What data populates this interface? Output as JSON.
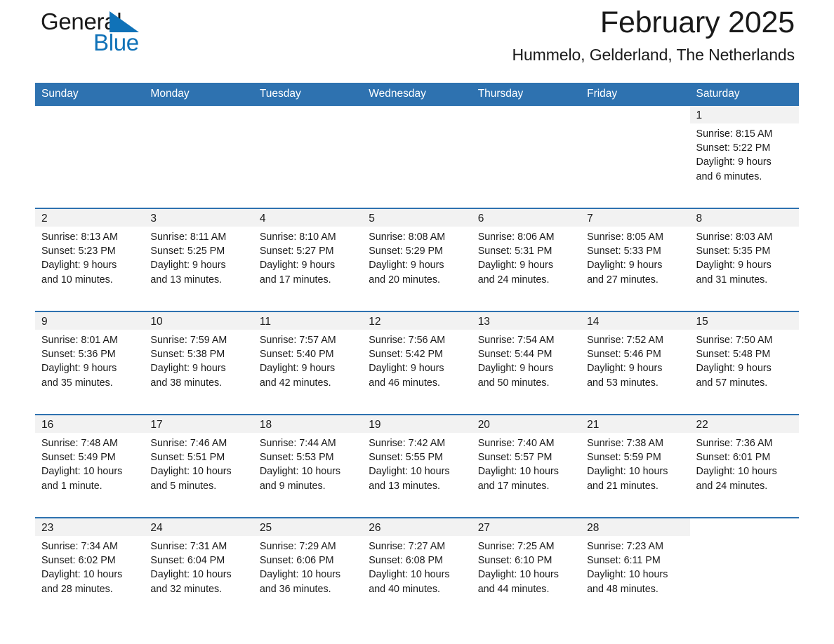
{
  "brand": {
    "name_part1": "General",
    "name_part2": "Blue",
    "color_primary": "#1072b8",
    "color_header": "#2e72b0"
  },
  "header": {
    "title": "February 2025",
    "subtitle": "Hummelo, Gelderland, The Netherlands"
  },
  "calendar": {
    "weekday_headers": [
      "Sunday",
      "Monday",
      "Tuesday",
      "Wednesday",
      "Thursday",
      "Friday",
      "Saturday"
    ],
    "weeks": [
      [
        {
          "day": "",
          "sunrise": "",
          "sunset": "",
          "daylight1": "",
          "daylight2": "",
          "empty": true
        },
        {
          "day": "",
          "sunrise": "",
          "sunset": "",
          "daylight1": "",
          "daylight2": "",
          "empty": true
        },
        {
          "day": "",
          "sunrise": "",
          "sunset": "",
          "daylight1": "",
          "daylight2": "",
          "empty": true
        },
        {
          "day": "",
          "sunrise": "",
          "sunset": "",
          "daylight1": "",
          "daylight2": "",
          "empty": true
        },
        {
          "day": "",
          "sunrise": "",
          "sunset": "",
          "daylight1": "",
          "daylight2": "",
          "empty": true
        },
        {
          "day": "",
          "sunrise": "",
          "sunset": "",
          "daylight1": "",
          "daylight2": "",
          "empty": true
        },
        {
          "day": "1",
          "sunrise": "Sunrise: 8:15 AM",
          "sunset": "Sunset: 5:22 PM",
          "daylight1": "Daylight: 9 hours",
          "daylight2": "and 6 minutes.",
          "empty": false
        }
      ],
      [
        {
          "day": "2",
          "sunrise": "Sunrise: 8:13 AM",
          "sunset": "Sunset: 5:23 PM",
          "daylight1": "Daylight: 9 hours",
          "daylight2": "and 10 minutes.",
          "empty": false
        },
        {
          "day": "3",
          "sunrise": "Sunrise: 8:11 AM",
          "sunset": "Sunset: 5:25 PM",
          "daylight1": "Daylight: 9 hours",
          "daylight2": "and 13 minutes.",
          "empty": false
        },
        {
          "day": "4",
          "sunrise": "Sunrise: 8:10 AM",
          "sunset": "Sunset: 5:27 PM",
          "daylight1": "Daylight: 9 hours",
          "daylight2": "and 17 minutes.",
          "empty": false
        },
        {
          "day": "5",
          "sunrise": "Sunrise: 8:08 AM",
          "sunset": "Sunset: 5:29 PM",
          "daylight1": "Daylight: 9 hours",
          "daylight2": "and 20 minutes.",
          "empty": false
        },
        {
          "day": "6",
          "sunrise": "Sunrise: 8:06 AM",
          "sunset": "Sunset: 5:31 PM",
          "daylight1": "Daylight: 9 hours",
          "daylight2": "and 24 minutes.",
          "empty": false
        },
        {
          "day": "7",
          "sunrise": "Sunrise: 8:05 AM",
          "sunset": "Sunset: 5:33 PM",
          "daylight1": "Daylight: 9 hours",
          "daylight2": "and 27 minutes.",
          "empty": false
        },
        {
          "day": "8",
          "sunrise": "Sunrise: 8:03 AM",
          "sunset": "Sunset: 5:35 PM",
          "daylight1": "Daylight: 9 hours",
          "daylight2": "and 31 minutes.",
          "empty": false
        }
      ],
      [
        {
          "day": "9",
          "sunrise": "Sunrise: 8:01 AM",
          "sunset": "Sunset: 5:36 PM",
          "daylight1": "Daylight: 9 hours",
          "daylight2": "and 35 minutes.",
          "empty": false
        },
        {
          "day": "10",
          "sunrise": "Sunrise: 7:59 AM",
          "sunset": "Sunset: 5:38 PM",
          "daylight1": "Daylight: 9 hours",
          "daylight2": "and 38 minutes.",
          "empty": false
        },
        {
          "day": "11",
          "sunrise": "Sunrise: 7:57 AM",
          "sunset": "Sunset: 5:40 PM",
          "daylight1": "Daylight: 9 hours",
          "daylight2": "and 42 minutes.",
          "empty": false
        },
        {
          "day": "12",
          "sunrise": "Sunrise: 7:56 AM",
          "sunset": "Sunset: 5:42 PM",
          "daylight1": "Daylight: 9 hours",
          "daylight2": "and 46 minutes.",
          "empty": false
        },
        {
          "day": "13",
          "sunrise": "Sunrise: 7:54 AM",
          "sunset": "Sunset: 5:44 PM",
          "daylight1": "Daylight: 9 hours",
          "daylight2": "and 50 minutes.",
          "empty": false
        },
        {
          "day": "14",
          "sunrise": "Sunrise: 7:52 AM",
          "sunset": "Sunset: 5:46 PM",
          "daylight1": "Daylight: 9 hours",
          "daylight2": "and 53 minutes.",
          "empty": false
        },
        {
          "day": "15",
          "sunrise": "Sunrise: 7:50 AM",
          "sunset": "Sunset: 5:48 PM",
          "daylight1": "Daylight: 9 hours",
          "daylight2": "and 57 minutes.",
          "empty": false
        }
      ],
      [
        {
          "day": "16",
          "sunrise": "Sunrise: 7:48 AM",
          "sunset": "Sunset: 5:49 PM",
          "daylight1": "Daylight: 10 hours",
          "daylight2": "and 1 minute.",
          "empty": false
        },
        {
          "day": "17",
          "sunrise": "Sunrise: 7:46 AM",
          "sunset": "Sunset: 5:51 PM",
          "daylight1": "Daylight: 10 hours",
          "daylight2": "and 5 minutes.",
          "empty": false
        },
        {
          "day": "18",
          "sunrise": "Sunrise: 7:44 AM",
          "sunset": "Sunset: 5:53 PM",
          "daylight1": "Daylight: 10 hours",
          "daylight2": "and 9 minutes.",
          "empty": false
        },
        {
          "day": "19",
          "sunrise": "Sunrise: 7:42 AM",
          "sunset": "Sunset: 5:55 PM",
          "daylight1": "Daylight: 10 hours",
          "daylight2": "and 13 minutes.",
          "empty": false
        },
        {
          "day": "20",
          "sunrise": "Sunrise: 7:40 AM",
          "sunset": "Sunset: 5:57 PM",
          "daylight1": "Daylight: 10 hours",
          "daylight2": "and 17 minutes.",
          "empty": false
        },
        {
          "day": "21",
          "sunrise": "Sunrise: 7:38 AM",
          "sunset": "Sunset: 5:59 PM",
          "daylight1": "Daylight: 10 hours",
          "daylight2": "and 21 minutes.",
          "empty": false
        },
        {
          "day": "22",
          "sunrise": "Sunrise: 7:36 AM",
          "sunset": "Sunset: 6:01 PM",
          "daylight1": "Daylight: 10 hours",
          "daylight2": "and 24 minutes.",
          "empty": false
        }
      ],
      [
        {
          "day": "23",
          "sunrise": "Sunrise: 7:34 AM",
          "sunset": "Sunset: 6:02 PM",
          "daylight1": "Daylight: 10 hours",
          "daylight2": "and 28 minutes.",
          "empty": false
        },
        {
          "day": "24",
          "sunrise": "Sunrise: 7:31 AM",
          "sunset": "Sunset: 6:04 PM",
          "daylight1": "Daylight: 10 hours",
          "daylight2": "and 32 minutes.",
          "empty": false
        },
        {
          "day": "25",
          "sunrise": "Sunrise: 7:29 AM",
          "sunset": "Sunset: 6:06 PM",
          "daylight1": "Daylight: 10 hours",
          "daylight2": "and 36 minutes.",
          "empty": false
        },
        {
          "day": "26",
          "sunrise": "Sunrise: 7:27 AM",
          "sunset": "Sunset: 6:08 PM",
          "daylight1": "Daylight: 10 hours",
          "daylight2": "and 40 minutes.",
          "empty": false
        },
        {
          "day": "27",
          "sunrise": "Sunrise: 7:25 AM",
          "sunset": "Sunset: 6:10 PM",
          "daylight1": "Daylight: 10 hours",
          "daylight2": "and 44 minutes.",
          "empty": false
        },
        {
          "day": "28",
          "sunrise": "Sunrise: 7:23 AM",
          "sunset": "Sunset: 6:11 PM",
          "daylight1": "Daylight: 10 hours",
          "daylight2": "and 48 minutes.",
          "empty": false
        },
        {
          "day": "",
          "sunrise": "",
          "sunset": "",
          "daylight1": "",
          "daylight2": "",
          "empty": true
        }
      ]
    ]
  }
}
